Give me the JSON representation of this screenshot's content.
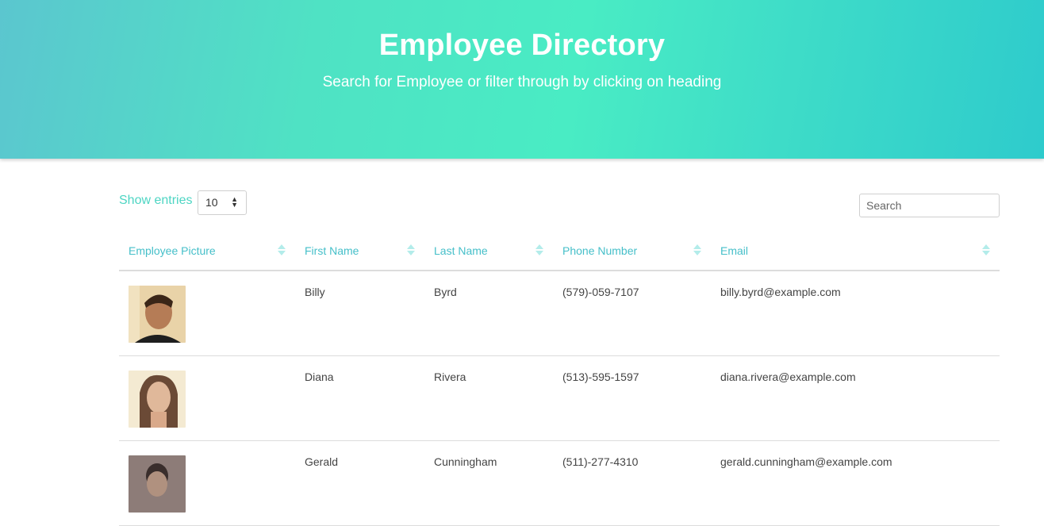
{
  "header": {
    "title": "Employee Directory",
    "subtitle": "Search for Employee or filter through by clicking on heading"
  },
  "controls": {
    "show_entries_label": "Show entries",
    "entries_value": "10",
    "search_placeholder": "Search"
  },
  "table": {
    "columns": [
      "Employee Picture",
      "First Name",
      "Last Name",
      "Phone Number",
      "Email"
    ],
    "rows": [
      {
        "first": "Billy",
        "last": "Byrd",
        "phone": "(579)-059-7107",
        "email": "billy.byrd@example.com",
        "avatar_tone": "#8a5a3a"
      },
      {
        "first": "Diana",
        "last": "Rivera",
        "phone": "(513)-595-1597",
        "email": "diana.rivera@example.com",
        "avatar_tone": "#a67c62"
      },
      {
        "first": "Gerald",
        "last": "Cunningham",
        "phone": "(511)-277-4310",
        "email": "gerald.cunningham@example.com",
        "avatar_tone": "#6b5a52"
      }
    ]
  },
  "colors": {
    "accent": "#4dd5c3",
    "header_text": "#45bfc9"
  }
}
